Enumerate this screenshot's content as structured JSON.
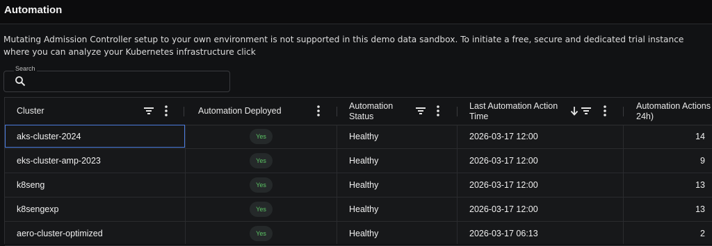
{
  "header": {
    "title": "Automation"
  },
  "notice": "Mutating Admission Controller setup to your own environment is not supported in this demo data sandbox. To initiate a free, secure and dedicated trial instance where you can analyze your Kubernetes infrastructure click",
  "search": {
    "label": "Search",
    "value": ""
  },
  "table": {
    "columns": [
      {
        "line1": "Cluster",
        "line2": ""
      },
      {
        "line1": "Automation Deployed",
        "line2": ""
      },
      {
        "line1": "Automation",
        "line2": "Status"
      },
      {
        "line1": "Last Automation Action",
        "line2": "Time"
      },
      {
        "line1": "Automation Actions (",
        "line2": "24h)"
      }
    ],
    "rows": [
      {
        "cluster": "aks-cluster-2024",
        "deployed": "Yes",
        "status": "Healthy",
        "time": "2026-03-17 12:00",
        "actions": "14"
      },
      {
        "cluster": "eks-cluster-amp-2023",
        "deployed": "Yes",
        "status": "Healthy",
        "time": "2026-03-17 12:00",
        "actions": "9"
      },
      {
        "cluster": "k8seng",
        "deployed": "Yes",
        "status": "Healthy",
        "time": "2026-03-17 12:00",
        "actions": "13"
      },
      {
        "cluster": "k8sengexp",
        "deployed": "Yes",
        "status": "Healthy",
        "time": "2026-03-17 12:00",
        "actions": "13"
      },
      {
        "cluster": "aero-cluster-optimized",
        "deployed": "Yes",
        "status": "Healthy",
        "time": "2026-03-17 06:13",
        "actions": "2"
      }
    ]
  },
  "colors": {
    "background": "#111214",
    "accent": "#4c7de0",
    "success": "#5cc565"
  }
}
